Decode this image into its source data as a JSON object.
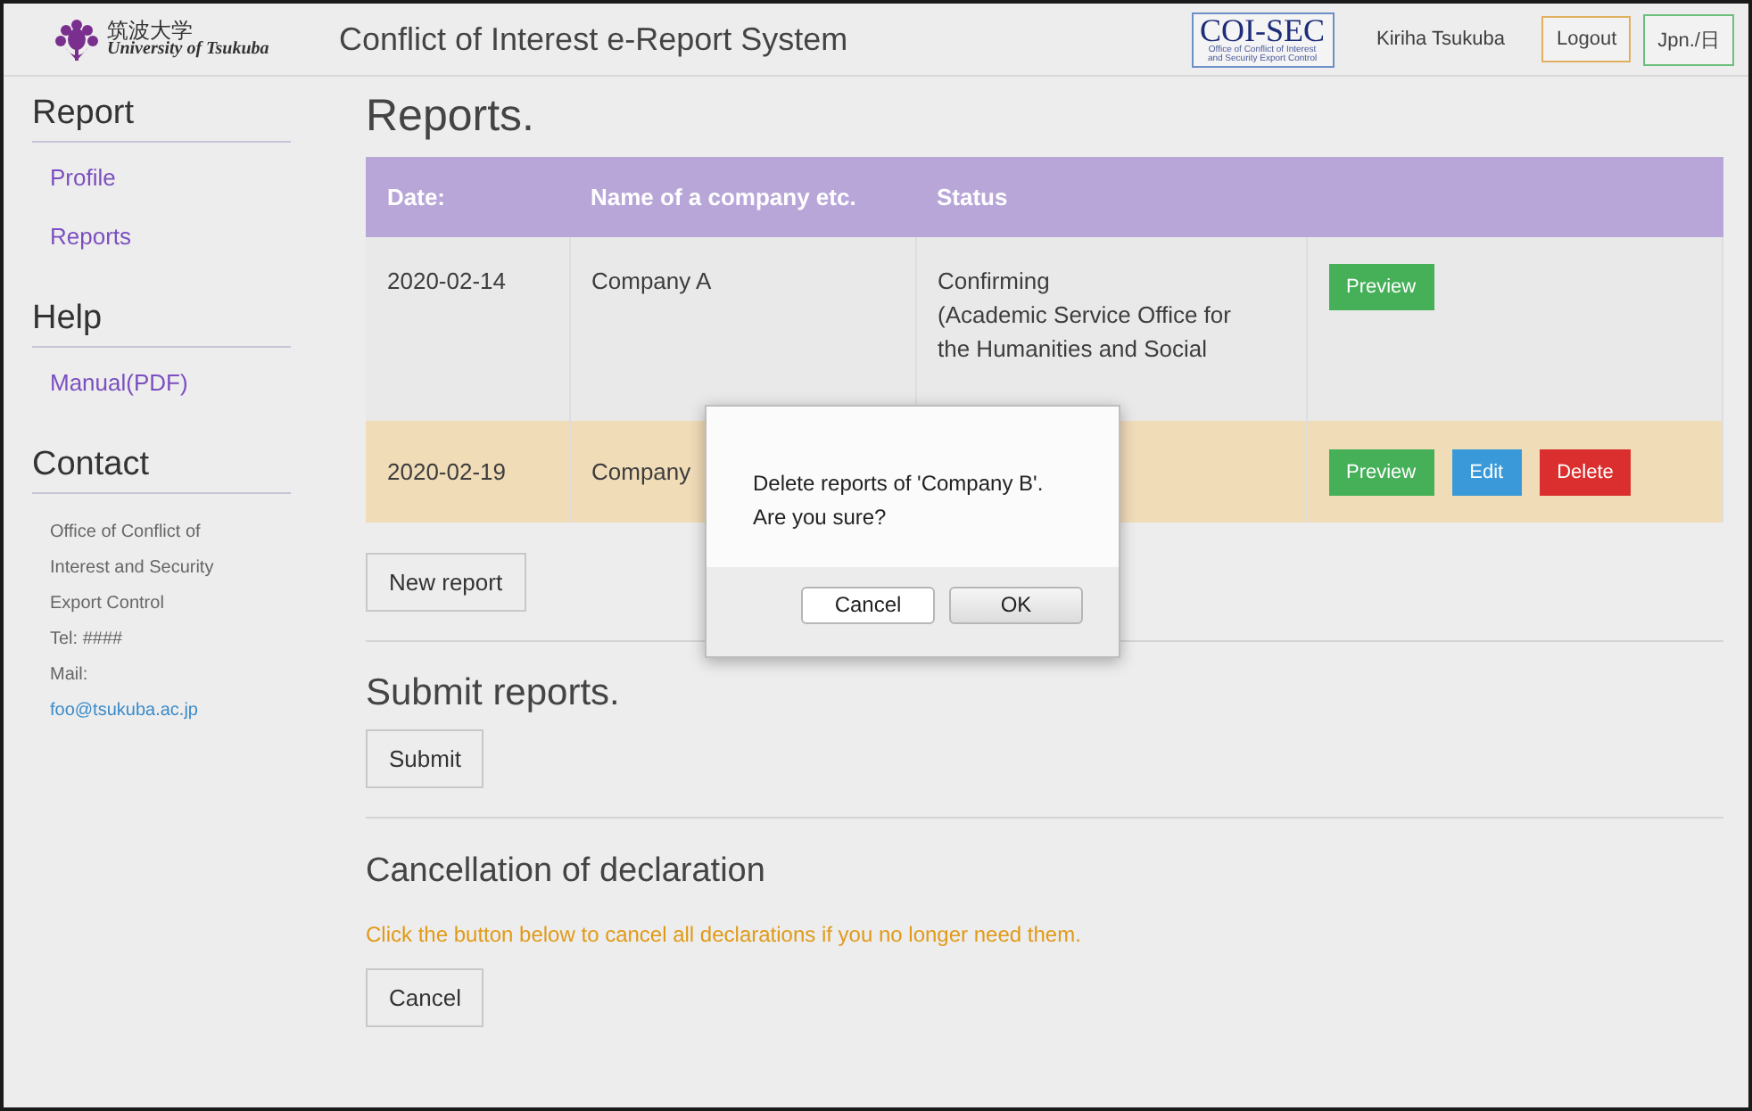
{
  "header": {
    "logo": {
      "name_ja": "筑波大学",
      "name_en": "University of Tsukuba"
    },
    "title": "Conflict of Interest e-Report System",
    "coi_logo": {
      "title": "COI-SEC",
      "subtitle_lines": [
        "Office of Conflict of Interest",
        "and Security Export Control"
      ]
    },
    "user": "Kiriha Tsukuba",
    "buttons": [
      {
        "label": "Logout",
        "kind": "warning"
      },
      {
        "label": "Jpn./日",
        "kind": "success"
      }
    ]
  },
  "sidebar": {
    "sections": [
      {
        "heading": "Report",
        "items": [
          {
            "kind": "link",
            "text": "Profile"
          },
          {
            "kind": "link",
            "text": "Reports"
          }
        ]
      },
      {
        "heading": "Help",
        "items": [
          {
            "kind": "link",
            "text": "Manual(PDF)"
          }
        ]
      },
      {
        "heading": "Contact",
        "items": [
          {
            "kind": "text",
            "text": "Office of Conflict of Interest and Security Export Control"
          },
          {
            "kind": "text",
            "text": "Tel: ####"
          },
          {
            "kind": "text",
            "text": "Mail:"
          },
          {
            "kind": "email",
            "text": "foo@tsukuba.ac.jp"
          }
        ]
      }
    ]
  },
  "main": {
    "title": "Reports.",
    "table": {
      "columns": [
        "Date:",
        "Name of a company etc.",
        "Status"
      ],
      "rows": [
        {
          "date": "2020-02-14",
          "company": "Company A",
          "status": [
            "Confirming",
            "(Academic Service Office for",
            "the Humanities and Social"
          ],
          "highlighted": false,
          "actions": [
            {
              "label": "Preview",
              "kind": "preview"
            }
          ]
        },
        {
          "date": "2020-02-19",
          "company": "Company",
          "status": [],
          "highlighted": true,
          "actions": [
            {
              "label": "Preview",
              "kind": "preview"
            },
            {
              "label": "Edit",
              "kind": "edit"
            },
            {
              "label": "Delete",
              "kind": "delete"
            }
          ]
        }
      ]
    },
    "new_report_button": "New report",
    "submit": {
      "heading": "Submit reports.",
      "button": "Submit"
    },
    "cancellation": {
      "heading": "Cancellation of declaration",
      "note": "Click the button below to cancel all declarations if you no longer need them.",
      "button": "Cancel"
    }
  },
  "dialog": {
    "message_lines": [
      "Delete reports of 'Company B'.",
      "Are you sure?"
    ],
    "buttons": [
      {
        "label": "Cancel",
        "default": false
      },
      {
        "label": "OK",
        "default": true
      }
    ]
  }
}
